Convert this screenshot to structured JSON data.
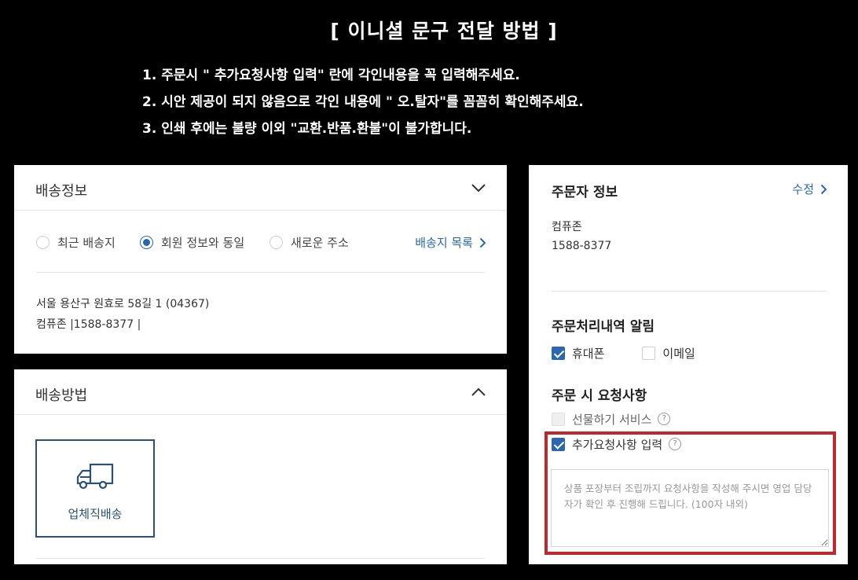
{
  "notice": {
    "title": "[ 이니셜 문구 전달 방법 ]",
    "items": [
      "1. 주문시 \" 추가요청사항 입력\" 란에 각인내용을 꼭 입력해주세요.",
      "2. 시안 제공이 되지 않음으로 각인 내용에 \" 오.탈자\"를 꼼꼼히 확인해주세요.",
      "3. 인쇄 후에는 불량 이외 \"교환.반품.환불\"이 불가합니다."
    ]
  },
  "shipping_info": {
    "title": "배송정보",
    "options": [
      {
        "label": "최근 배송지",
        "selected": false
      },
      {
        "label": "회원 정보와 동일",
        "selected": true
      },
      {
        "label": "새로운 주소",
        "selected": false
      }
    ],
    "address_list_link": "배송지 목록",
    "address_line": "서울 용산구 원효로 58길 1 (04367)",
    "contact_line": "컴퓨존 |1588-8377 |"
  },
  "shipping_method": {
    "title": "배송방법",
    "option_label": "업체직배송",
    "option_icon": "truck-icon"
  },
  "orderer": {
    "title": "주문자 정보",
    "edit_link": "수정",
    "name": "컴퓨존",
    "phone": "1588-8377"
  },
  "notifications": {
    "title": "주문처리내역 알림",
    "mobile_label": "휴대폰",
    "mobile_checked": true,
    "email_label": "이메일",
    "email_checked": false
  },
  "order_request": {
    "title": "주문 시 요청사항",
    "gift_label": "선물하기 서비스",
    "gift_checked": false,
    "extra_label": "추가요청사항 입력",
    "extra_checked": true,
    "placeholder": "상품 포장부터 조립까지 요청사항을 작성해 주시면 영업 담당자가 확인 후 진행해 드립니다. (100자 내외)"
  },
  "colors": {
    "accent": "#2a67b0",
    "method_border": "#2a5176",
    "highlight": "#c1272d",
    "background": "#000000"
  }
}
